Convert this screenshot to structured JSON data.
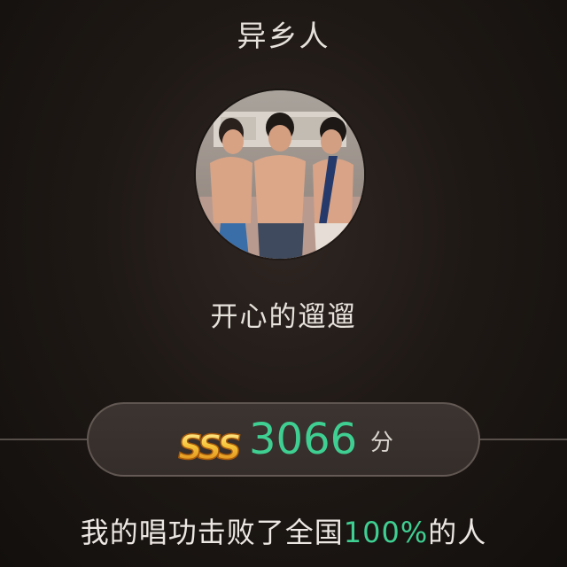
{
  "song": {
    "title": "异乡人"
  },
  "user": {
    "avatar_icon": "user-avatar-photo",
    "name": "开心的遛遛"
  },
  "score": {
    "grade": "SSS",
    "value": "3066",
    "unit": "分"
  },
  "summary": {
    "prefix": "我的唱功击败了全国",
    "percent": "100%",
    "suffix": "的人"
  },
  "colors": {
    "accent_green": "#3fcf92",
    "background": "#1f1915",
    "pill": "#3c3430",
    "grade_gold": "#f0b22a"
  }
}
